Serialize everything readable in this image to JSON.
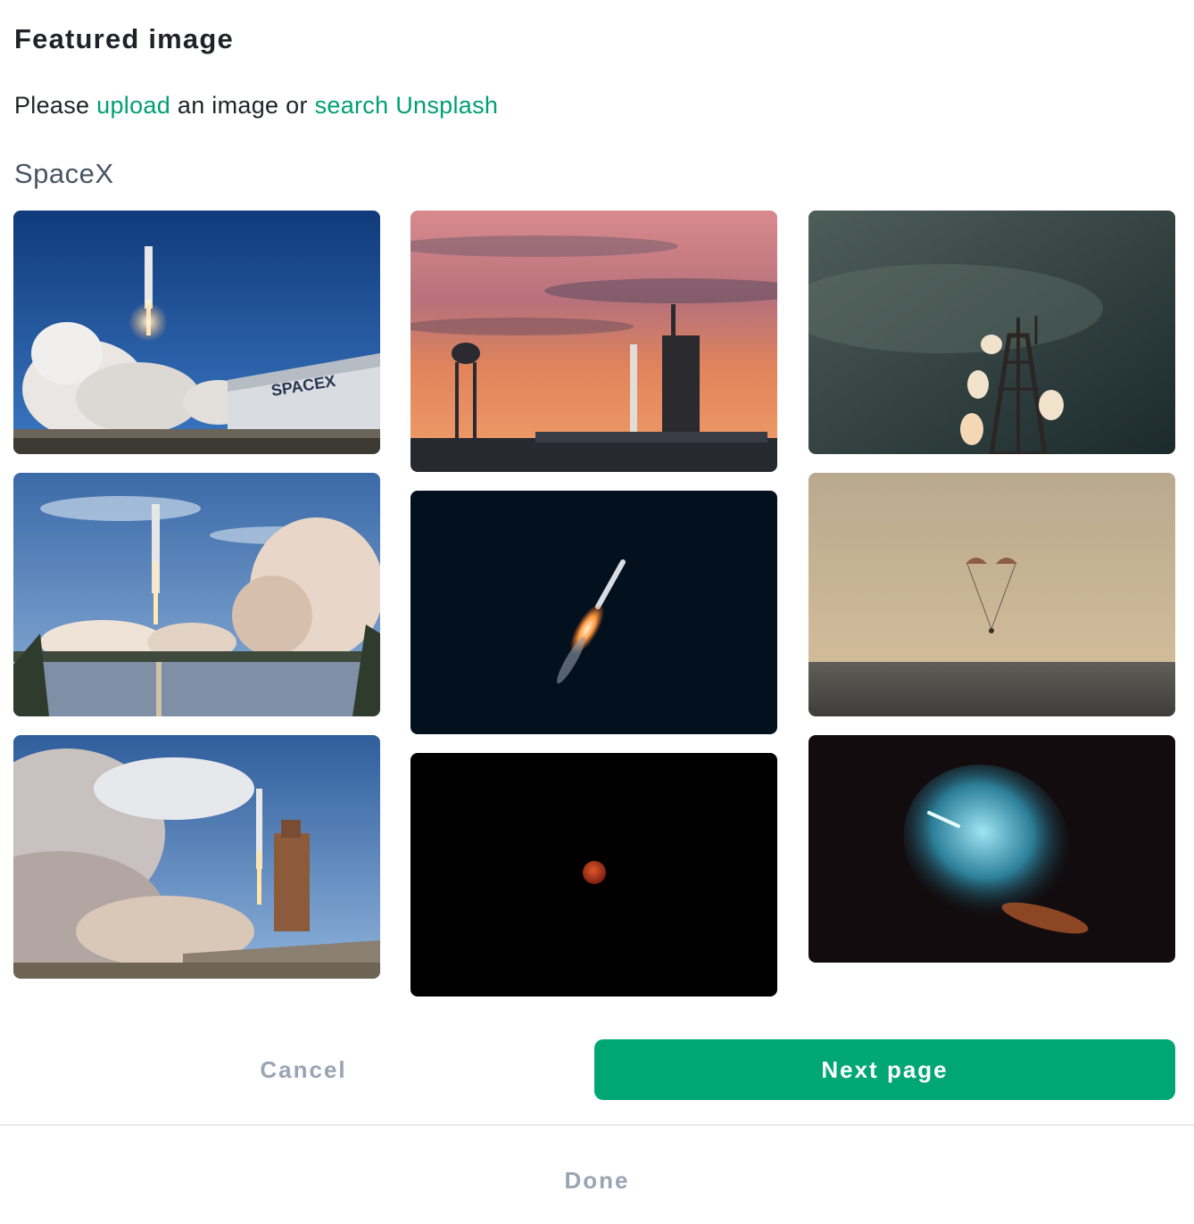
{
  "header": {
    "title": "Featured image"
  },
  "intro": {
    "prefix": "Please",
    "upload_link": "upload",
    "middle": "an image or",
    "search_link": "search Unsplash"
  },
  "search": {
    "query": "SpaceX"
  },
  "gallery": {
    "images": [
      {
        "name": "Falcon Heavy launch beside SpaceX hangar",
        "hangar_text": "SPACEX"
      },
      {
        "name": "Launch pad and water tower at sunset"
      },
      {
        "name": "Antenna tower under starry sky"
      },
      {
        "name": "Rocket launch with smoke reflected in water"
      },
      {
        "name": "Rocket ascending in dark sky"
      },
      {
        "name": "Capsule descending under parachutes over sea"
      },
      {
        "name": "Rocket launch with billowing clouds"
      },
      {
        "name": "Red moon in black sky"
      },
      {
        "name": "Blue rocket exhaust plume at night"
      }
    ]
  },
  "footer": {
    "cancel_label": "Cancel",
    "next_label": "Next page",
    "done_label": "Done"
  },
  "colors": {
    "accent": "#00a673",
    "link": "#00a070",
    "muted_button": "#9aa5b4"
  }
}
